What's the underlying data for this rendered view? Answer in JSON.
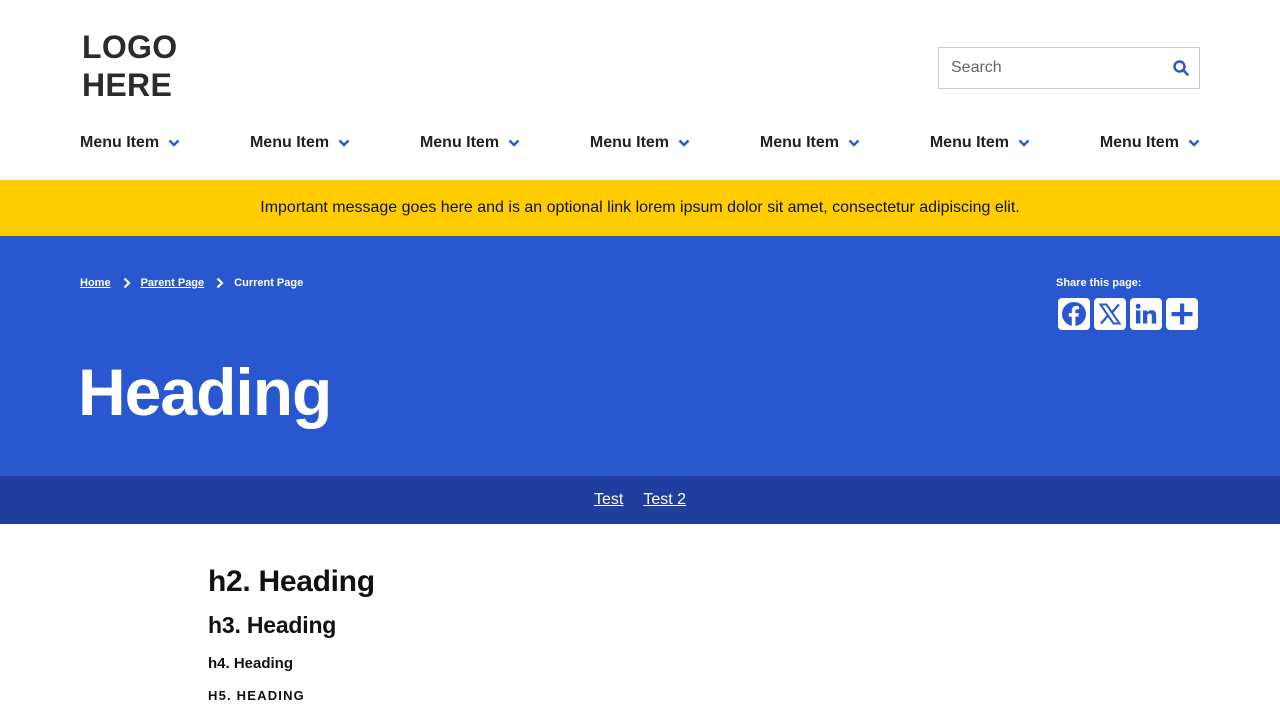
{
  "header": {
    "logo_line1": "LOGO",
    "logo_line2": "HERE",
    "search": {
      "placeholder": "Search",
      "icon": "search-icon"
    }
  },
  "nav": {
    "items": [
      {
        "label": "Menu Item",
        "icon": "chevron-down-icon"
      },
      {
        "label": "Menu Item",
        "icon": "chevron-down-icon"
      },
      {
        "label": "Menu Item",
        "icon": "chevron-down-icon"
      },
      {
        "label": "Menu Item",
        "icon": "chevron-down-icon"
      },
      {
        "label": "Menu Item",
        "icon": "chevron-down-icon"
      },
      {
        "label": "Menu Item",
        "icon": "chevron-down-icon"
      },
      {
        "label": "Menu Item",
        "icon": "chevron-down-icon"
      }
    ]
  },
  "alert": {
    "message": "Important message goes here and is an optional link lorem ipsum dolor sit amet, consectetur adipiscing elit."
  },
  "hero": {
    "breadcrumb": {
      "home": "Home",
      "parent": "Parent Page",
      "current": "Current Page"
    },
    "title": "Heading",
    "share": {
      "label": "Share this page:",
      "services": [
        "facebook-icon",
        "x-icon",
        "linkedin-icon",
        "plus-icon"
      ]
    }
  },
  "subnav": {
    "links": [
      "Test",
      "Test 2"
    ]
  },
  "content": {
    "h2": "h2. Heading",
    "h3": "h3. Heading",
    "h4": "h4. Heading",
    "h5": "H5. Heading"
  },
  "colors": {
    "primary": "#2957d0",
    "primary_dark": "#1f3e9e",
    "alert": "#ffcd00",
    "text": "#222222"
  }
}
